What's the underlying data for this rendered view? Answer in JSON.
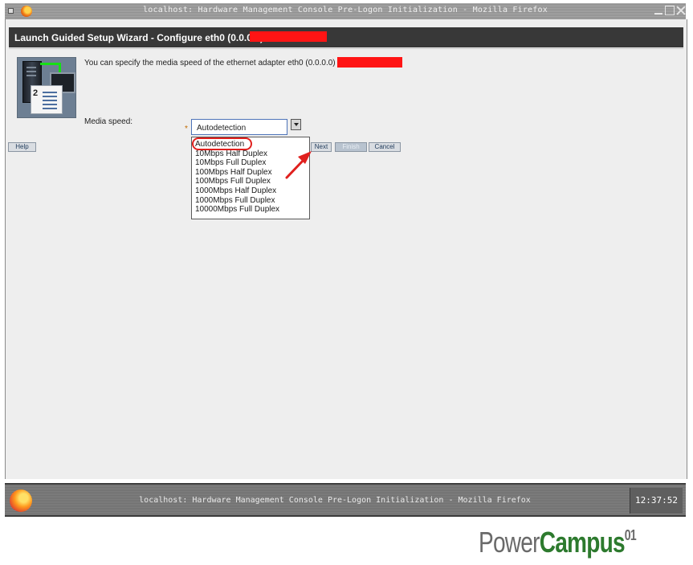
{
  "window": {
    "title": "localhost: Hardware Management Console Pre-Logon Initialization - Mozilla Firefox",
    "icon": "firefox-icon"
  },
  "wizard": {
    "header_title": "Launch Guided Setup Wizard - Configure eth0 (0.0.0.0)",
    "description": "You can specify the media speed of the ethernet adapter eth0 (0.0.0.0)",
    "redaction_color": "#ff1414",
    "media_speed_label": "Media speed:",
    "required_marker": "*",
    "selected_value": "Autodetection",
    "options": [
      "Autodetection",
      "10Mbps Half Duplex",
      "10Mbps Full Duplex",
      "100Mbps Half Duplex",
      "100Mbps Full Duplex",
      "1000Mbps Half Duplex",
      "1000Mbps Full Duplex",
      "10000Mbps Full Duplex"
    ],
    "buttons": {
      "help": "Help",
      "next": "Next",
      "finish": "Finish",
      "cancel": "Cancel"
    },
    "annotation_color": "#e0201e"
  },
  "taskbar": {
    "title": "localhost: Hardware Management Console Pre-Logon Initialization - Mozilla Firefox",
    "clock": "12:37:52"
  },
  "watermark": {
    "part1": "Power",
    "part2": "Campus",
    "superscript": "01"
  }
}
